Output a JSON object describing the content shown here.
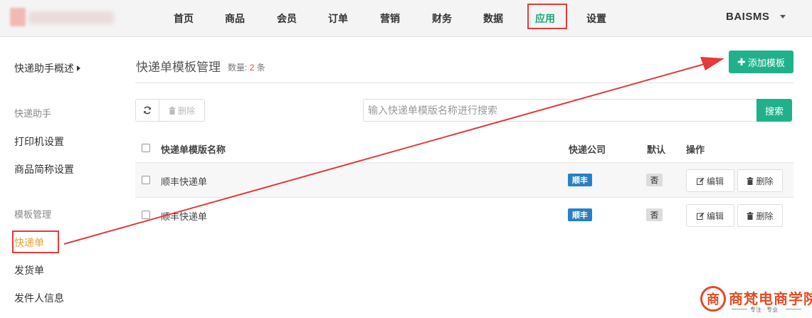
{
  "nav": {
    "items": [
      "首页",
      "商品",
      "会员",
      "订单",
      "营销",
      "财务",
      "数据",
      "应用",
      "设置"
    ],
    "active": "应用",
    "user": "BAISMS"
  },
  "sidebar": {
    "overview": "快递助手概述",
    "group1": "快递助手",
    "printer": "打印机设置",
    "short_name": "商品简称设置",
    "group2": "模板管理",
    "express": "快递单",
    "delivery": "发货单",
    "sender": "发件人信息"
  },
  "main": {
    "title": "快递单模板管理",
    "count_label": "数量:",
    "count_value": "2",
    "count_unit": "条",
    "add_button": "添加模板",
    "delete_button": "删除",
    "search_placeholder": "输入快递单模版名称进行搜索",
    "search_button": "搜索",
    "columns": [
      "快递单模版名称",
      "快递公司",
      "默认",
      "操作"
    ],
    "rows": [
      {
        "name": "顺丰快递单",
        "company": "顺丰",
        "default": "否",
        "edit": "编辑",
        "remove": "删除"
      },
      {
        "name": "顺丰快递单",
        "company": "顺丰",
        "default": "否",
        "edit": "编辑",
        "remove": "删除"
      }
    ]
  },
  "colors": {
    "accent": "#21b18a",
    "annotation": "#e43a3a",
    "badge": "#2a7fc4",
    "current": "#e8a13a"
  },
  "watermark": {
    "logo_char": "商",
    "text": "商梵电商学院",
    "subtitle": "专注 · 专业"
  }
}
